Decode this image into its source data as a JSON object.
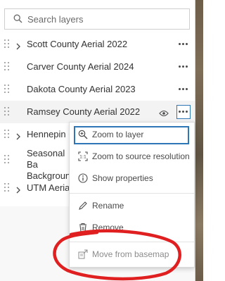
{
  "search": {
    "placeholder": "Search layers",
    "value": ""
  },
  "layers": [
    {
      "label": "Scott County Aerial 2022",
      "expandable": true
    },
    {
      "label": "Carver County Aerial 2024",
      "expandable": false
    },
    {
      "label": "Dakota County Aerial 2023",
      "expandable": false
    },
    {
      "label": "Ramsey County Aerial 2022",
      "expandable": false,
      "selected": true,
      "visible": true
    },
    {
      "label": "Hennepin Co",
      "expandable": true
    },
    {
      "label": "Seasonal Ba Background",
      "expandable": false
    },
    {
      "label": "UTM Aerial 2",
      "expandable": true
    }
  ],
  "context_menu": {
    "items": [
      {
        "label": "Zoom to layer",
        "icon": "zoom-to-layer-icon",
        "focused": true
      },
      {
        "label": "Zoom to source resolution",
        "icon": "source-resolution-icon"
      },
      {
        "label": "Show properties",
        "icon": "info-icon"
      },
      {
        "label": "Rename",
        "icon": "pencil-icon"
      },
      {
        "label": "Remove",
        "icon": "trash-icon"
      },
      {
        "label": "Move from basemap",
        "icon": "move-from-basemap-icon",
        "disabled": true
      }
    ]
  },
  "colors": {
    "accent": "#2f76b6",
    "annotation": "#e02020",
    "text": "#323232"
  }
}
